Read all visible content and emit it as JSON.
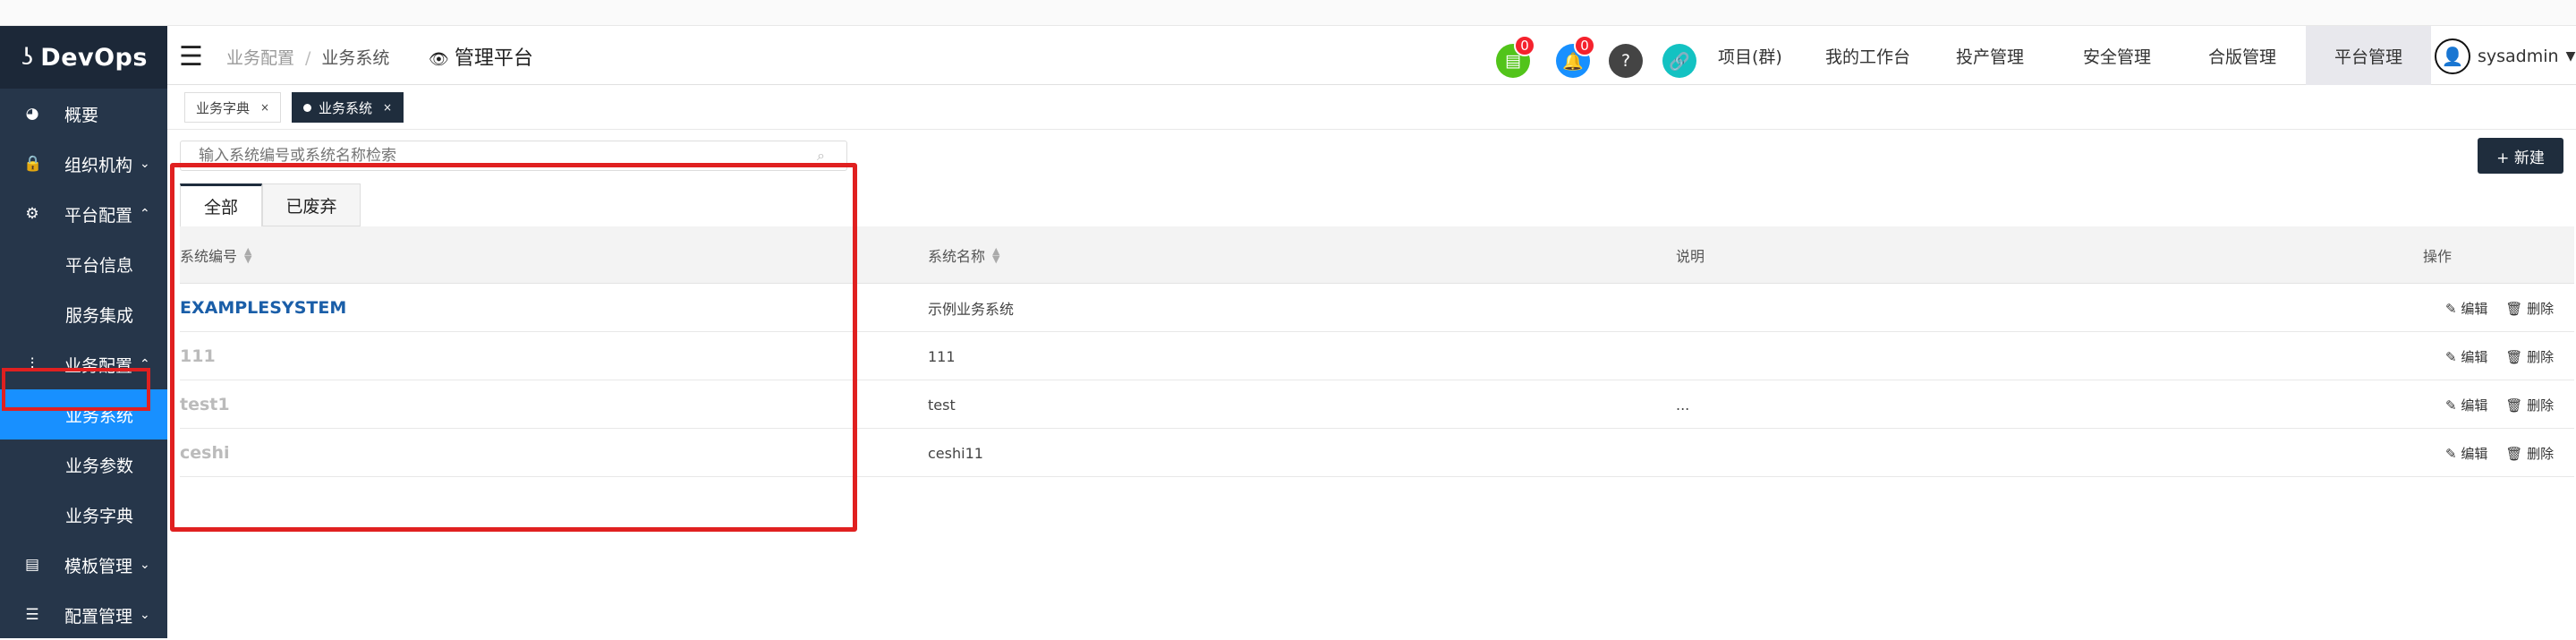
{
  "app": {
    "logo_mark": "ʖ",
    "name": "DevOps"
  },
  "sidebar": {
    "items": [
      {
        "label": "概要",
        "icon": "dashboard-icon",
        "glyph": "◕"
      },
      {
        "label": "组织机构",
        "icon": "lock-icon",
        "glyph": "🔒",
        "chevron": "⌄"
      },
      {
        "label": "平台配置",
        "icon": "gear-icon",
        "glyph": "⚙",
        "chevron": "⌃"
      },
      {
        "label": "平台信息",
        "sub": true
      },
      {
        "label": "服务集成",
        "sub": true
      },
      {
        "label": "业务配置",
        "icon": "sliders-icon",
        "glyph": "⫶",
        "chevron": "⌃"
      },
      {
        "label": "业务系统",
        "sub": true,
        "active": true
      },
      {
        "label": "业务参数",
        "sub": true
      },
      {
        "label": "业务字典",
        "sub": true
      },
      {
        "label": "模板管理",
        "icon": "template-icon",
        "glyph": "▤",
        "chevron": "⌄"
      },
      {
        "label": "配置管理",
        "icon": "database-icon",
        "glyph": "☰",
        "chevron": "⌄"
      }
    ]
  },
  "header": {
    "breadcrumb": [
      "业务配置",
      "业务系统"
    ],
    "breadcrumb_sep": "/",
    "platform_label": "管理平台",
    "icons": [
      {
        "name": "task-icon",
        "glyph": "▤",
        "color": "#52c41a",
        "badge": "0"
      },
      {
        "name": "bell-icon",
        "glyph": "🔔",
        "color": "#1890ff",
        "badge": "0"
      },
      {
        "name": "help-icon",
        "glyph": "?",
        "color": "#444444"
      },
      {
        "name": "link-icon",
        "glyph": "🔗",
        "color": "#13c2c2"
      }
    ],
    "nav": [
      "项目(群)",
      "我的工作台",
      "投产管理",
      "安全管理",
      "合版管理",
      "平台管理"
    ],
    "nav_active": "平台管理",
    "user": "sysadmin"
  },
  "view_tabs": [
    {
      "label": "业务字典",
      "active": false
    },
    {
      "label": "业务系统",
      "active": true
    }
  ],
  "toolbar": {
    "search_placeholder": "输入系统编号或系统名称检索",
    "new_button": "+ 新建"
  },
  "filter_tabs": [
    "全部",
    "已废弃"
  ],
  "table": {
    "columns": [
      "系统编号",
      "系统名称",
      "说明",
      "操作"
    ],
    "rows": [
      {
        "code": "EXAMPLESYSTEM",
        "name": "示例业务系统",
        "desc": "",
        "link": true
      },
      {
        "code": "111",
        "name": "111",
        "desc": ""
      },
      {
        "code": "test1",
        "name": "test",
        "desc": "..."
      },
      {
        "code": "ceshi",
        "name": "ceshi11",
        "desc": ""
      }
    ],
    "ops": [
      "编辑",
      "删除"
    ]
  },
  "colors": {
    "sidebar": "#26364a",
    "active": "#1890ff",
    "highlight": "#e02020",
    "dark_button": "#1f2d3d"
  }
}
